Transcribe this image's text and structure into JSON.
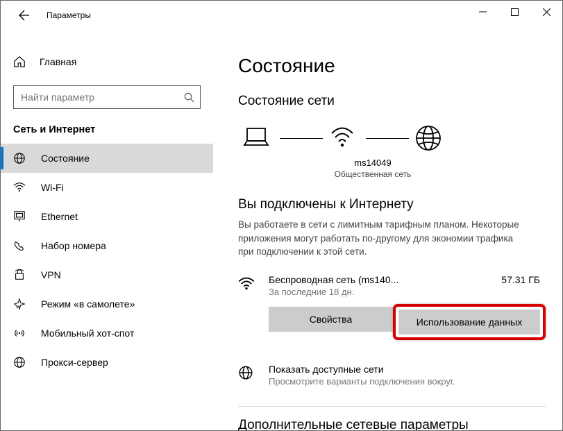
{
  "window": {
    "title": "Параметры"
  },
  "sidebar": {
    "home": "Главная",
    "search_placeholder": "Найти параметр",
    "section": "Сеть и Интернет",
    "items": [
      {
        "label": "Состояние"
      },
      {
        "label": "Wi-Fi"
      },
      {
        "label": "Ethernet"
      },
      {
        "label": "Набор номера"
      },
      {
        "label": "VPN"
      },
      {
        "label": "Режим «в самолете»"
      },
      {
        "label": "Мобильный хот-спот"
      },
      {
        "label": "Прокси-сервер"
      }
    ]
  },
  "main": {
    "title": "Состояние",
    "status_heading": "Состояние сети",
    "ssid": "ms14049",
    "net_kind": "Общественная сеть",
    "connected_title": "Вы подключены к Интернету",
    "connected_desc": "Вы работаете в сети с лимитным тарифным планом. Некоторые приложения могут работать по-другому для экономии трафика при подключении к этой сети.",
    "connection": {
      "name": "Беспроводная сеть (ms140...",
      "period": "За последние 18 дн.",
      "usage": "57.31 ГБ"
    },
    "btn_props": "Свойства",
    "btn_usage": "Использование данных",
    "show_nets_title": "Показать доступные сети",
    "show_nets_desc": "Просмотрите варианты подключения вокруг.",
    "extra_title": "Дополнительные сетевые параметры"
  }
}
